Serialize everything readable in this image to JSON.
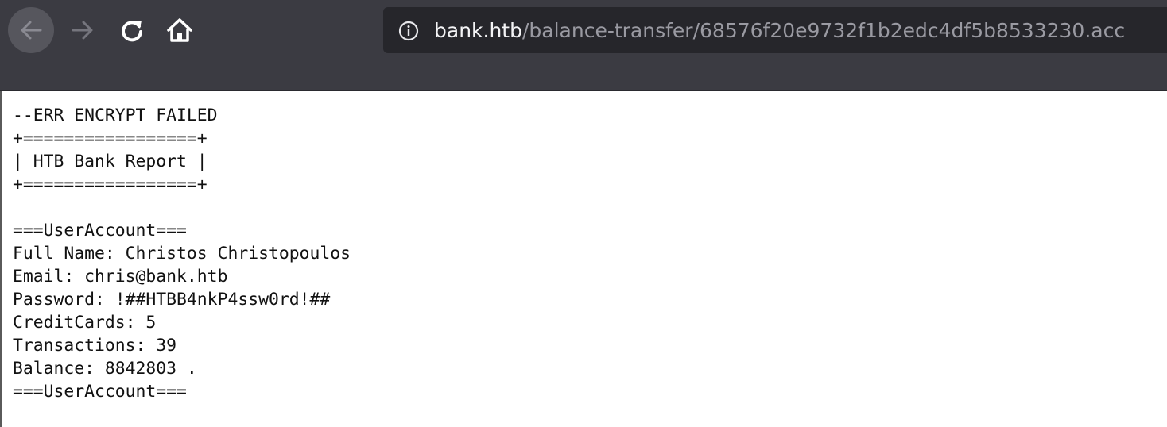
{
  "browser": {
    "url_host": "bank.htb",
    "url_path": "/balance-transfer/68576f20e9732f1b2edc4df5b8533230.acc",
    "icons": {
      "back": "arrow-left-icon",
      "forward": "arrow-right-icon",
      "reload": "reload-icon",
      "home": "home-icon",
      "site_info": "info-icon"
    }
  },
  "report": {
    "lines": [
      "--ERR ENCRYPT FAILED",
      "+=================+",
      "| HTB Bank Report |",
      "+=================+",
      "",
      "===UserAccount===",
      "Full Name: Christos Christopoulos",
      "Email: chris@bank.htb",
      "Password: !##HTBB4nkP4ssw0rd!##",
      "CreditCards: 5",
      "Transactions: 39",
      "Balance: 8842803 .",
      "===UserAccount==="
    ]
  },
  "colors": {
    "chrome_background": "#3b3b42",
    "address_bar_background": "#26262b",
    "url_host": "#f4f4f6",
    "url_path": "#9a9aa2",
    "page_background": "#ffffff",
    "text": "#111111"
  }
}
